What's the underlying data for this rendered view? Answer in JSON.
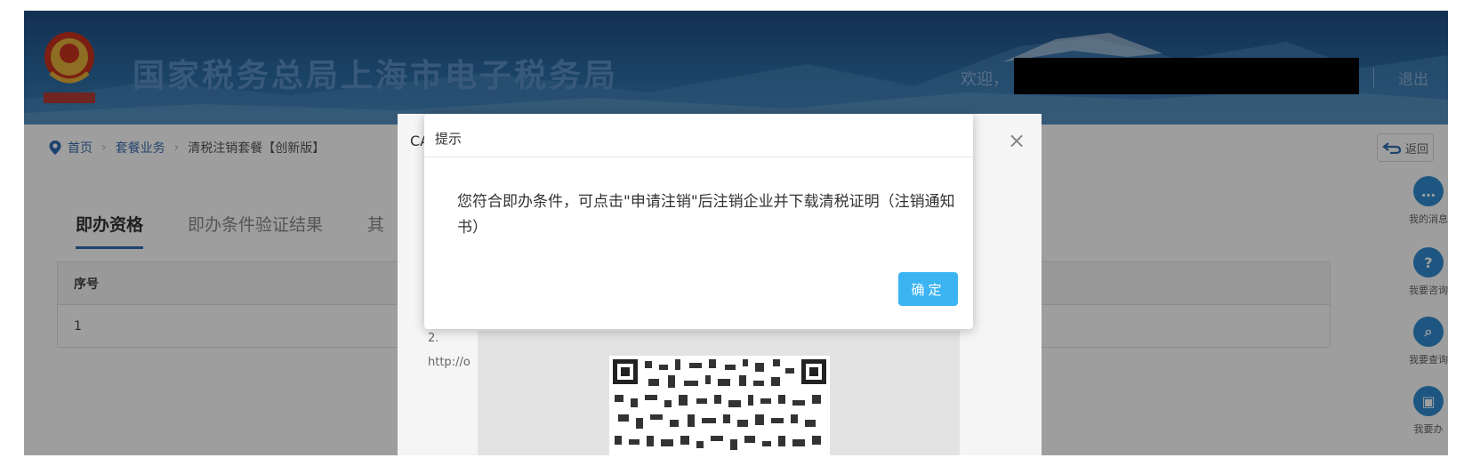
{
  "header": {
    "site_title": "国家税务总局上海市电子税务局",
    "emblem_caption": "十字标",
    "welcome_label": "欢迎，",
    "logout_label": "退出"
  },
  "breadcrumb": {
    "items": [
      "首页",
      "套餐业务",
      "清税注销套餐【创新版】"
    ],
    "back_label": "返回"
  },
  "tabs": [
    {
      "label": "即办资格",
      "active": true
    },
    {
      "label": "即办条件验证结果",
      "active": false
    },
    {
      "label": "其",
      "active": false
    }
  ],
  "table": {
    "header": "序号",
    "rows": [
      "1"
    ]
  },
  "right_tools": [
    {
      "label": "我的消息",
      "icon": "message-icon",
      "glyph": "…"
    },
    {
      "label": "我要咨询",
      "icon": "question-icon",
      "glyph": "?"
    },
    {
      "label": "我要查询",
      "icon": "search-icon",
      "glyph": "⌕"
    },
    {
      "label": "我要办",
      "icon": "form-icon",
      "glyph": "▣"
    }
  ],
  "ca_dialog": {
    "title": "CA",
    "close_glyph": "×",
    "body_lines": "温\n1.\n序\n2.\nhttp://o"
  },
  "tip_dialog": {
    "title": "提示",
    "message": "您符合即办条件，可点击\"申请注销\"后注销企业并下载清税证明（注销通知书）",
    "ok_label": "确定"
  },
  "colors": {
    "banner": "#2b6ba3",
    "accent_blue": "#2f6db3",
    "ok_button": "#3cb4f2",
    "tool_circle": "#2f8dd0"
  }
}
